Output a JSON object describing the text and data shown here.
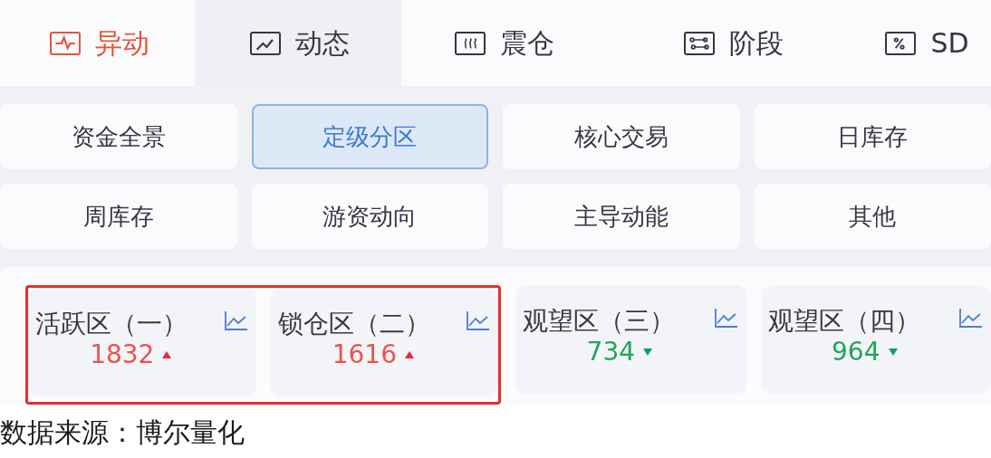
{
  "tabs": [
    {
      "label": "异动",
      "kind": "pulse",
      "selected": true,
      "hovered": false
    },
    {
      "label": "动态",
      "kind": "line",
      "selected": false,
      "hovered": true
    },
    {
      "label": "震仓",
      "kind": "wave",
      "selected": false,
      "hovered": false
    },
    {
      "label": "阶段",
      "kind": "nodes",
      "selected": false,
      "hovered": false
    },
    {
      "label": "SD",
      "kind": "percent",
      "selected": false,
      "hovered": false
    }
  ],
  "categories": [
    {
      "label": "资金全景",
      "selected": false
    },
    {
      "label": "定级分区",
      "selected": true
    },
    {
      "label": "核心交易",
      "selected": false
    },
    {
      "label": "日库存",
      "selected": false
    },
    {
      "label": "周库存",
      "selected": false
    },
    {
      "label": "游资动向",
      "selected": false
    },
    {
      "label": "主导动能",
      "selected": false
    },
    {
      "label": "其他",
      "selected": false
    }
  ],
  "zones": [
    {
      "title": "活跃区（一）",
      "value": "1832",
      "kind": "up",
      "highlighted": true
    },
    {
      "title": "锁仓区（二）",
      "value": "1616",
      "kind": "up",
      "highlighted": true
    },
    {
      "title": "观望区（三）",
      "value": "734",
      "kind": "down",
      "highlighted": false
    },
    {
      "title": "观望区（四）",
      "value": "964",
      "kind": "down",
      "highlighted": false
    }
  ],
  "source_note": "数据来源：博尔量化"
}
